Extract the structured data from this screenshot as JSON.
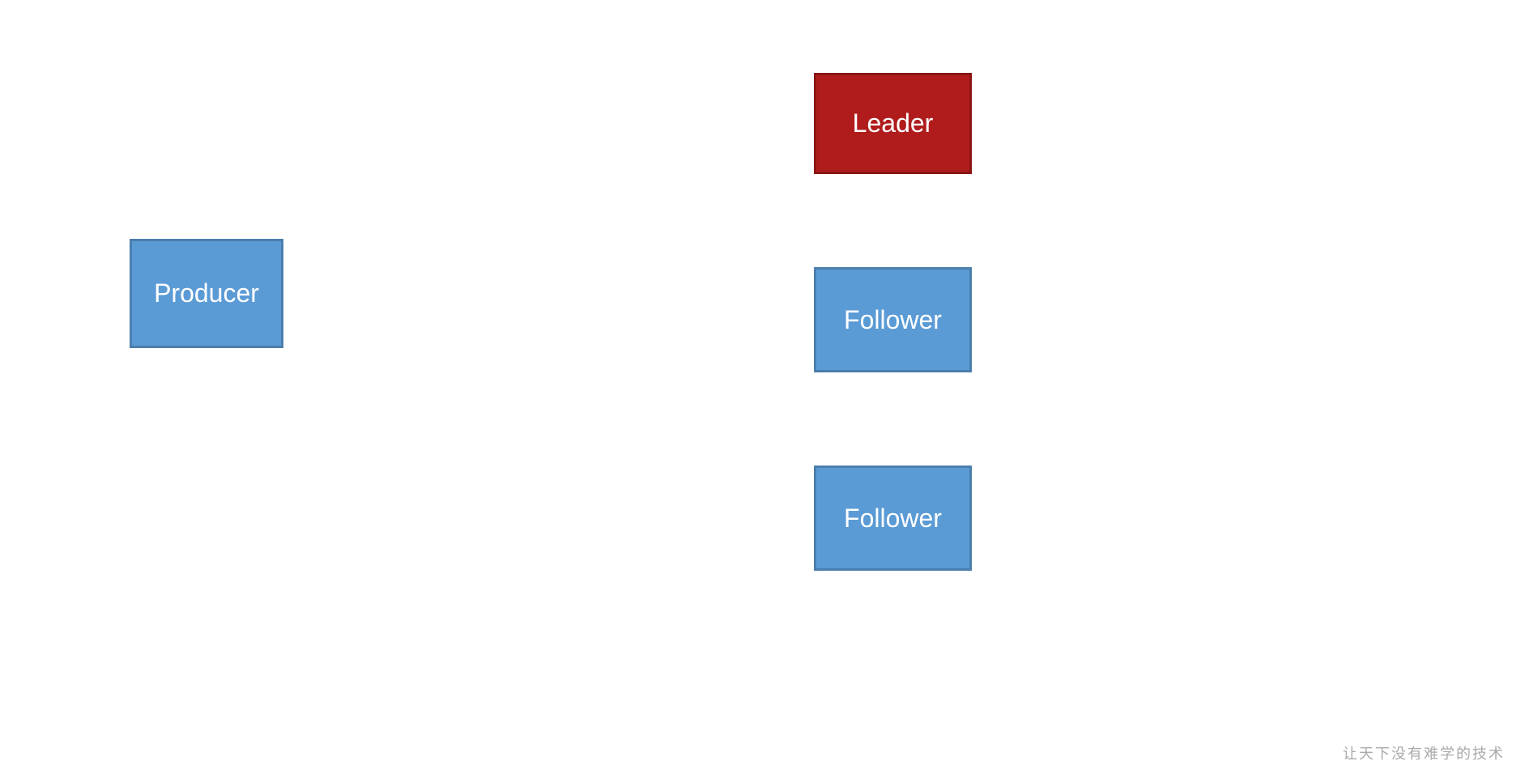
{
  "nodes": {
    "producer": {
      "label": "Producer",
      "color": "#5b9bd5",
      "borderColor": "#4a7ead"
    },
    "leader": {
      "label": "Leader",
      "color": "#b01c1c",
      "borderColor": "#8b1515"
    },
    "follower1": {
      "label": "Follower",
      "color": "#5b9bd5",
      "borderColor": "#4a7ead"
    },
    "follower2": {
      "label": "Follower",
      "color": "#5b9bd5",
      "borderColor": "#4a7ead"
    }
  },
  "watermark": {
    "text": "让天下没有难学的技术"
  }
}
